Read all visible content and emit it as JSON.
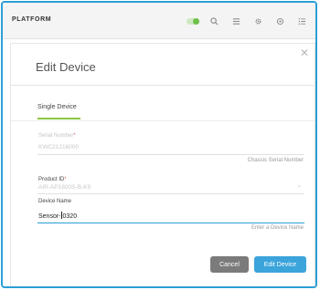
{
  "header": {
    "brand": "PLATFORM",
    "icons": [
      "toggle-switch",
      "search-icon",
      "list-icon",
      "gear-icon",
      "target-icon",
      "menu-icon"
    ],
    "toggle_color": "#6cc04a"
  },
  "dialog": {
    "title": "Edit Device",
    "close_symbol": "✕",
    "tabs": [
      {
        "label": "Single Device",
        "active": true
      }
    ],
    "accent_color": "#8cc63f",
    "fields": {
      "serial": {
        "label": "Serial Number",
        "required": "*",
        "value": "KWC21216000",
        "hint": "Chassis Serial Number"
      },
      "product": {
        "label": "Product ID",
        "required": "*",
        "value": "AIR-AP1800S-B-K9",
        "caret": "⌄"
      },
      "device_name": {
        "label": "Device Name",
        "value_before": "Sensor-",
        "value_after": "0320",
        "hint": "Enter a Device Name"
      }
    },
    "buttons": {
      "cancel": "Cancel",
      "submit": "Edit Device"
    }
  }
}
